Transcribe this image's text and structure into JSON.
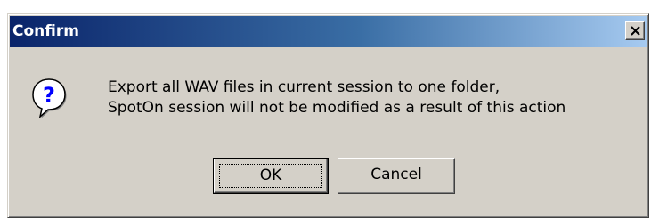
{
  "dialog": {
    "title": "Confirm",
    "icon": "question-icon",
    "message_lines": [
      "Export all WAV files in current session to one folder,",
      "SpotOn session will not be modified as a result of this action"
    ],
    "buttons": {
      "ok_label": "OK",
      "cancel_label": "Cancel"
    },
    "colors": {
      "title_bar_start": "#0a246a",
      "title_bar_end": "#a6caf0",
      "face": "#d4d0c8"
    }
  }
}
